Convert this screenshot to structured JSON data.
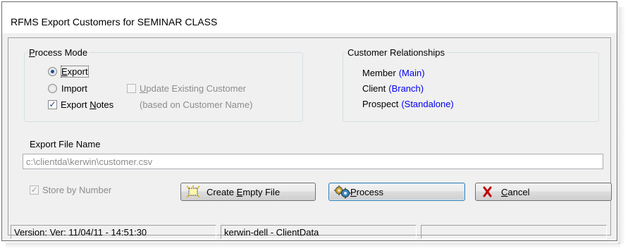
{
  "window": {
    "title": "RFMS Export Customers for SEMINAR CLASS"
  },
  "process_mode": {
    "legend_underlined": "P",
    "legend_rest": "rocess Mode",
    "export_label_u": "E",
    "export_label_rest": "xport",
    "import_label": "Import",
    "update_label_u": "U",
    "update_label_rest": "pdate Existing Customer",
    "export_notes_label_pre": "Export ",
    "export_notes_label_u": "N",
    "export_notes_label_rest": "otes",
    "based_on_label": "(based on Customer Name)",
    "export_selected": true,
    "export_notes_checked": true,
    "update_checked": false
  },
  "relationships": {
    "legend": "Customer Relationships",
    "items": [
      {
        "name": "Member",
        "type": "(Main)"
      },
      {
        "name": "Client",
        "type": "(Branch)"
      },
      {
        "name": "Prospect",
        "type": "(Standalone)"
      }
    ]
  },
  "export_file": {
    "label": "Export File Name",
    "value": "c:\\clientda\\kerwin\\customer.csv"
  },
  "store_by_number": {
    "label": "Store by Number",
    "checked": true
  },
  "buttons": {
    "create_pre": "Create ",
    "create_u": "E",
    "create_rest": "mpty File",
    "process_u": "P",
    "process_rest": "rocess",
    "cancel_u": "C",
    "cancel_rest": "ancel"
  },
  "status": {
    "version": "Version: Ver: 11/04/11 - 14:51:30",
    "user": "kerwin-dell - ClientData",
    "extra": ""
  },
  "colors": {
    "link_blue": "#0000ee",
    "cancel_x": "#c00000"
  }
}
